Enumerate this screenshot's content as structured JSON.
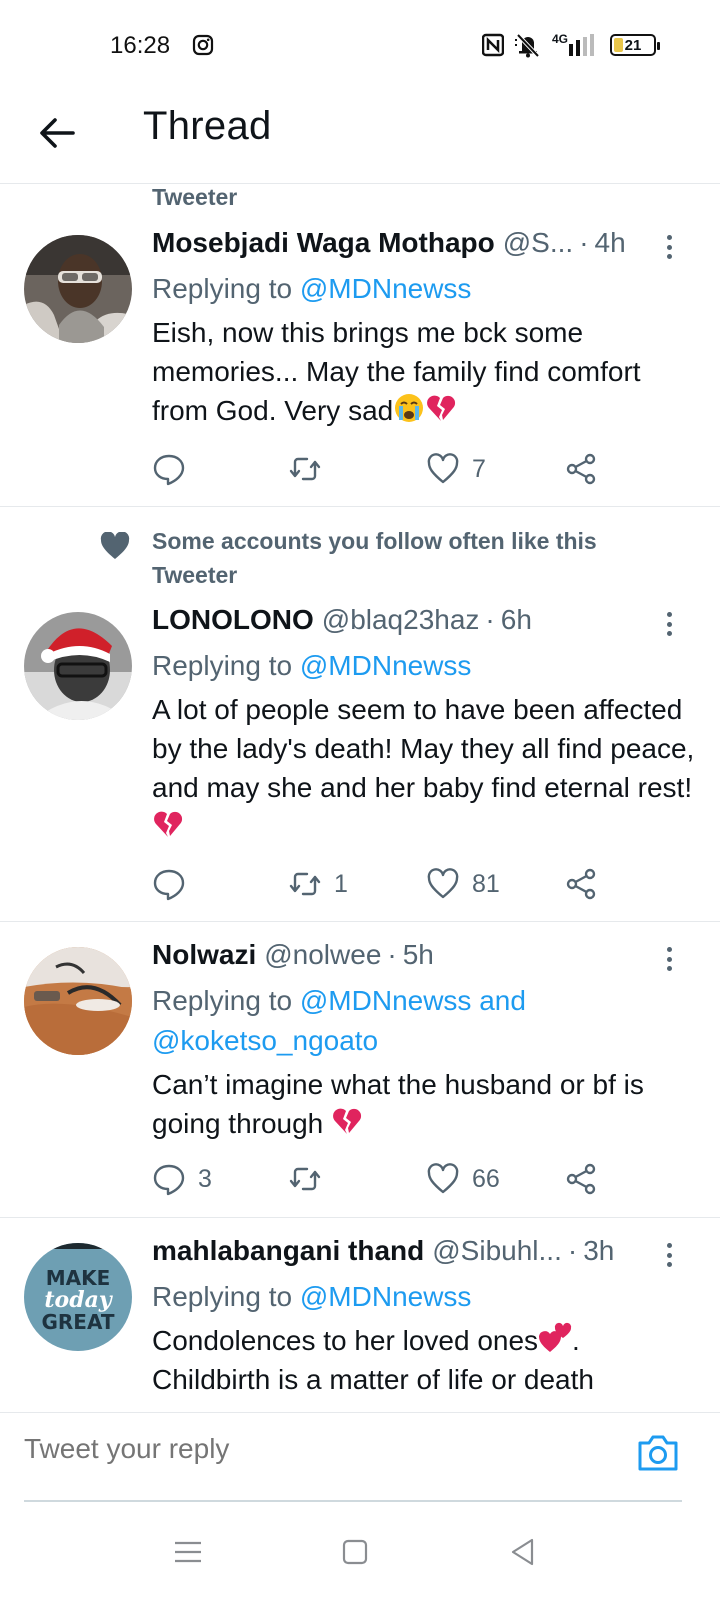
{
  "status_bar": {
    "time": "16:28",
    "network": "4G",
    "battery": "21"
  },
  "header": {
    "title": "Thread"
  },
  "tweets": [
    {
      "context": "Tweeter",
      "name": "Mosebjadi Waga Mothapo",
      "handle": "@S...",
      "time": "4h",
      "replying_prefix": "Replying to",
      "replying_to": "@MDNnewss",
      "text": "Eish, now this brings me bck some memories... May the family find comfort from God. Very sad",
      "reply_count": "",
      "retweet_count": "",
      "like_count": "7"
    },
    {
      "context": "Some accounts you follow often like this Tweeter",
      "name": "LONOLONO",
      "handle": "@blaq23haz",
      "time": "6h",
      "replying_prefix": "Replying to",
      "replying_to": "@MDNnewss",
      "text": "A lot of people seem to have been affected by the lady's death! May they all find peace, and may she and her baby find eternal rest!",
      "reply_count": "",
      "retweet_count": "1",
      "like_count": "81"
    },
    {
      "name": "Nolwazi",
      "handle": "@nolwee",
      "time": "5h",
      "replying_prefix": "Replying to",
      "replying_to": "@MDNnewss and",
      "replying_to_2": "@koketso_ngoato",
      "text": "Can’t imagine what the husband or bf is going through",
      "reply_count": "3",
      "retweet_count": "",
      "like_count": "66"
    },
    {
      "name": "mahlabangani thand",
      "handle": "@Sibuhl...",
      "time": "3h",
      "replying_prefix": "Replying to",
      "replying_to": "@MDNnewss",
      "text": "Condolences to her loved ones",
      "text_after_emoji": ".",
      "text_2": "Childbirth is a matter of life or death",
      "avatar_text": [
        "MAKE",
        "today",
        "GREAT"
      ]
    }
  ],
  "compose": {
    "placeholder": "Tweet your reply"
  },
  "colors": {
    "accent": "#1d9bf0",
    "secondary_text": "#536471",
    "divider": "#e6e9ec"
  },
  "icons": {
    "back": "arrow-left-icon",
    "more": "more-vertical-icon",
    "reply": "reply-icon",
    "retweet": "retweet-icon",
    "like": "heart-icon",
    "share": "share-icon",
    "camera": "camera-icon"
  }
}
